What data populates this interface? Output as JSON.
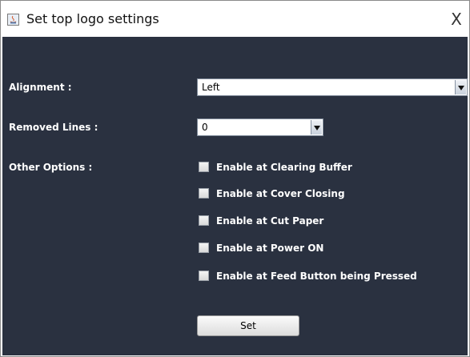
{
  "window": {
    "title": "Set top logo settings",
    "close_glyph": "X",
    "icon": "java-app-icon"
  },
  "colors": {
    "background": "#2a3140",
    "label_text": "#ffffff"
  },
  "alignment": {
    "label": "Alignment :",
    "value": "Left"
  },
  "removed_lines": {
    "label": "Removed Lines :",
    "value": "0"
  },
  "other_options": {
    "label": "Other Options :",
    "items": [
      {
        "label": "Enable at Clearing Buffer",
        "checked": false
      },
      {
        "label": "Enable at Cover Closing",
        "checked": false
      },
      {
        "label": "Enable at Cut Paper",
        "checked": false
      },
      {
        "label": "Enable at Power ON",
        "checked": false
      },
      {
        "label": "Enable at Feed Button being Pressed",
        "checked": false
      }
    ]
  },
  "set_button": {
    "label": "Set"
  }
}
